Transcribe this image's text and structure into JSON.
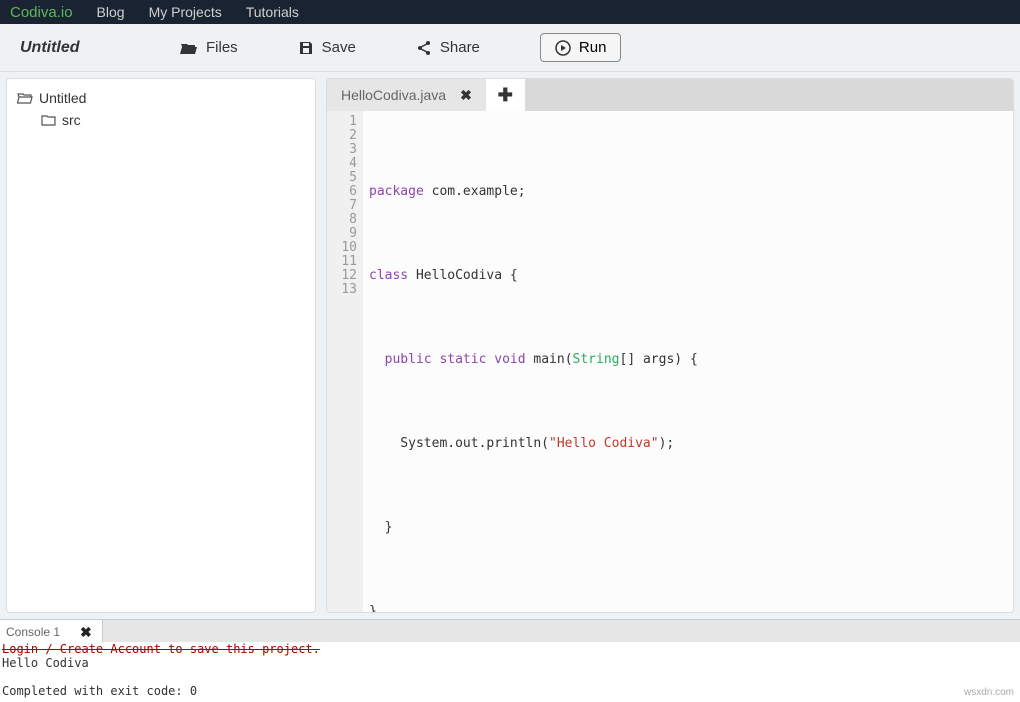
{
  "nav": {
    "brand": "Codiva.io",
    "links": [
      "Blog",
      "My Projects",
      "Tutorials"
    ]
  },
  "toolbar": {
    "project_title": "Untitled",
    "files_label": "Files",
    "save_label": "Save",
    "share_label": "Share",
    "run_label": "Run"
  },
  "filetree": {
    "root": "Untitled",
    "folder": "src"
  },
  "editor": {
    "tab_name": "HelloCodiva.java",
    "line_numbers": [
      "1",
      "2",
      "3",
      "4",
      "5",
      "6",
      "7",
      "8",
      "9",
      "10",
      "11",
      "12",
      "13"
    ],
    "code": {
      "l2_kw": "package",
      "l2_rest": " com.example;",
      "l4_kw": "class",
      "l4_rest": " HelloCodiva {",
      "l6_pub": "public",
      "l6_static": "static",
      "l6_void": "void",
      "l6_main": " main(",
      "l6_string": "String",
      "l6_rest": "[] args) {",
      "l8_pre": "    System.out.println(",
      "l8_str": "\"Hello Codiva\"",
      "l8_post": ");",
      "l10": "  }",
      "l12": "}"
    }
  },
  "console": {
    "tab_label": "Console 1",
    "login_line": "Login / Create Account to save this project.",
    "output_line": "Hello Codiva",
    "exit_line": "Completed with exit code: 0"
  },
  "watermark": "wsxdn.com"
}
